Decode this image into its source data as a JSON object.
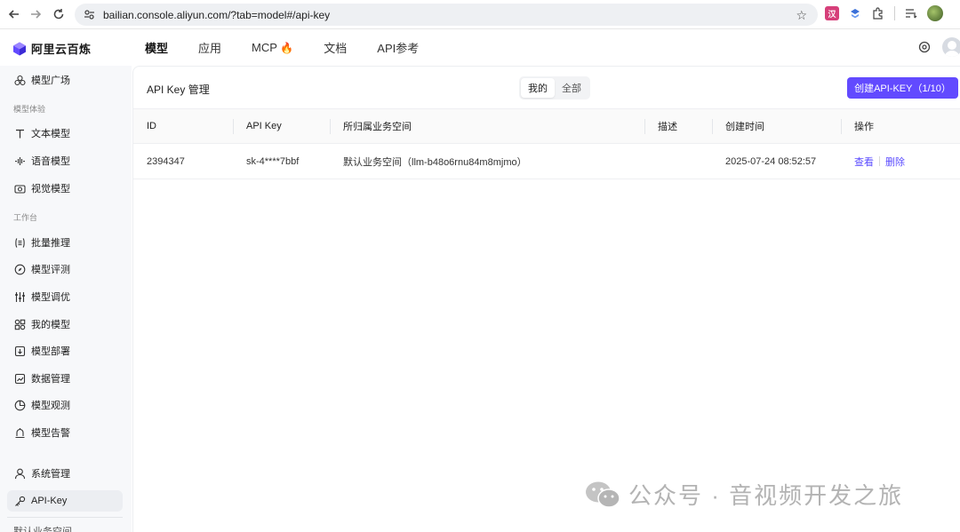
{
  "browser": {
    "url": "bailian.console.aliyun.com/?tab=model#/api-key"
  },
  "app": {
    "logo_text": "阿里云百炼",
    "nav": [
      {
        "label": "模型"
      },
      {
        "label": "应用"
      },
      {
        "label": "MCP"
      },
      {
        "label": "文档"
      },
      {
        "label": "API参考"
      }
    ],
    "mcp_flame": "🔥"
  },
  "sidebar": {
    "items": [
      {
        "label": "模型广场",
        "icon": "model-square-icon"
      },
      {
        "label": "文本模型",
        "icon": "text-icon"
      },
      {
        "label": "语音模型",
        "icon": "audio-icon"
      },
      {
        "label": "视觉模型",
        "icon": "camera-icon"
      },
      {
        "label": "批量推理",
        "icon": "batch-icon"
      },
      {
        "label": "模型评测",
        "icon": "compass-icon"
      },
      {
        "label": "模型调优",
        "icon": "sliders-icon"
      },
      {
        "label": "我的模型",
        "icon": "grid-icon"
      },
      {
        "label": "模型部署",
        "icon": "deploy-icon"
      },
      {
        "label": "数据管理",
        "icon": "chart-icon"
      },
      {
        "label": "模型观测",
        "icon": "pie-icon"
      },
      {
        "label": "模型告警",
        "icon": "alarm-icon"
      },
      {
        "label": "系统管理",
        "icon": "user-icon"
      },
      {
        "label": "API-Key",
        "icon": "key-icon"
      }
    ],
    "groups": [
      "模型体验",
      "工作台"
    ],
    "cut_text": "默认业务空间"
  },
  "main": {
    "title": "API Key 管理",
    "filter": {
      "mine": "我的",
      "all": "全部",
      "selected": "我的"
    },
    "create_button": "创建API-KEY（1/10）",
    "table": {
      "headers": [
        "ID",
        "API Key",
        "所归属业务空间",
        "描述",
        "创建时间",
        "操作"
      ],
      "rows": [
        {
          "id": "2394347",
          "api_key": "sk-4****7bbf",
          "workspace": "默认业务空间（llm-b48o6rnu84m8mjmo）",
          "description": "",
          "created": "2025-07-24 08:52:57",
          "view": "查看",
          "delete": "删除"
        }
      ]
    }
  },
  "watermark": "公众号 · 音视频开发之旅",
  "colors": {
    "accent": "#624aff",
    "link": "#5a4bff"
  }
}
